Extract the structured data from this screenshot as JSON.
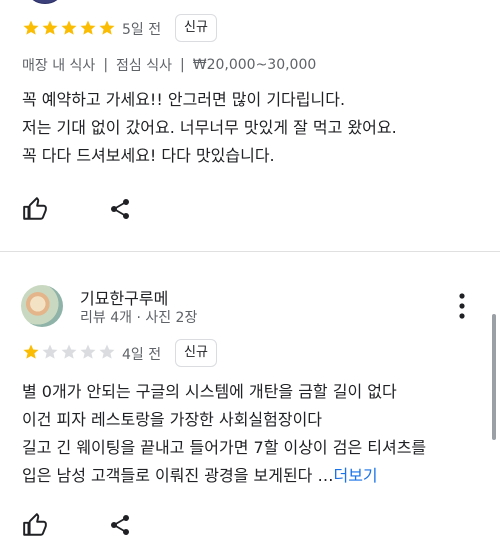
{
  "review1": {
    "rating": 5,
    "time": "5일 전",
    "badge": "신규",
    "tags": [
      "매장 내 식사",
      "점심 식사",
      "₩20,000~30,000"
    ],
    "text": [
      "꼭 예약하고 가세요!! 안그러면 많이 기다립니다.",
      "저는 기대 없이 갔어요. 너무너무 맛있게 잘 먹고 왔어요.",
      "꼭 다다 드셔보세요! 다다 맛있습니다."
    ],
    "actions": {
      "like_icon": "thumbs-up-icon",
      "share_icon": "share-icon"
    }
  },
  "review2": {
    "author": "기묘한구루메",
    "author_meta": "리뷰 4개 · 사진 2장",
    "rating": 1,
    "time": "4일 전",
    "badge": "신규",
    "text": [
      "별 0개가 안되는 구글의 시스템에 개탄을 금할 길이 없다",
      "이건 피자 레스토랑을 가장한 사회실험장이다",
      "길고 긴 웨이팅을 끝내고 들어가면 7할 이상이 검은 티셔츠를",
      "입은 남성 고객들로 이뤄진 광경을 보게된다 …"
    ],
    "more_label": "더보기",
    "menu_icon": "more-vert-icon"
  },
  "colors": {
    "star_filled": "#fbbc04",
    "star_empty": "#dadce0",
    "link": "#1a73e8"
  }
}
